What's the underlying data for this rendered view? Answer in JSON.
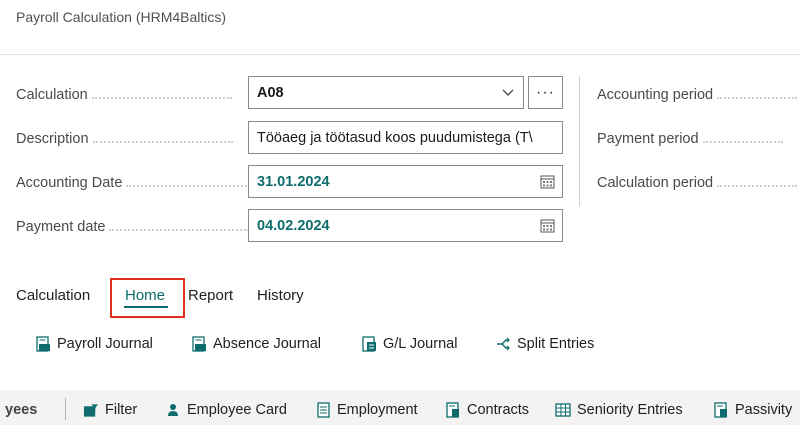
{
  "page": {
    "title": "Payroll Calculation (HRM4Baltics)"
  },
  "fields": {
    "calculation": {
      "label": "Calculation",
      "value": "A08"
    },
    "description": {
      "label": "Description",
      "value": "Tööaeg ja töötasud koos puudumistega (T\\"
    },
    "accounting_date": {
      "label": "Accounting Date",
      "value": "31.01.2024"
    },
    "payment_date": {
      "label": "Payment date",
      "value": "04.02.2024"
    }
  },
  "right_fields": {
    "accounting_period": {
      "label": "Accounting period"
    },
    "payment_period": {
      "label": "Payment period"
    },
    "calculation_period": {
      "label": "Calculation period"
    }
  },
  "more_button": {
    "label": "···"
  },
  "tabs": [
    {
      "label": "Calculation"
    },
    {
      "label": "Home"
    },
    {
      "label": "Report"
    },
    {
      "label": "History"
    }
  ],
  "actions": [
    {
      "label": "Payroll Journal",
      "icon": "journal-icon"
    },
    {
      "label": "Absence Journal",
      "icon": "journal-icon"
    },
    {
      "label": "G/L Journal",
      "icon": "gl-journal-icon"
    },
    {
      "label": "Split Entries",
      "icon": "split-icon"
    }
  ],
  "bottombar": {
    "group": "yees",
    "items": [
      {
        "label": "Filter",
        "icon": "filter-icon"
      },
      {
        "label": "Employee Card",
        "icon": "person-icon"
      },
      {
        "label": "Employment",
        "icon": "document-icon"
      },
      {
        "label": "Contracts",
        "icon": "document-icon"
      },
      {
        "label": "Seniority Entries",
        "icon": "table-icon"
      },
      {
        "label": "Passivity",
        "icon": "document-icon"
      }
    ]
  },
  "colors": {
    "accent": "#0e6c6c",
    "highlight": "#e0301e"
  }
}
